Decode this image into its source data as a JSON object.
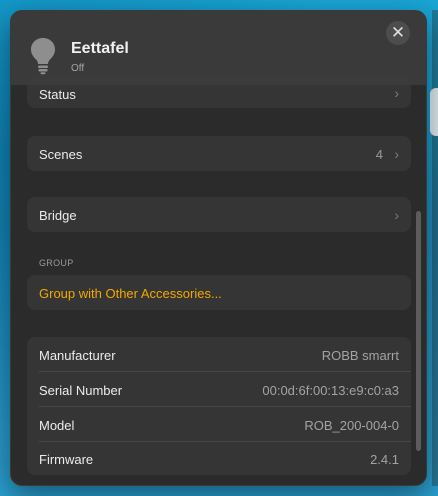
{
  "accessory": {
    "name": "Eettafel",
    "state": "Off",
    "icon": "lightbulb-icon"
  },
  "close_label": "✕",
  "rows": {
    "status": {
      "label": "Status"
    },
    "scenes": {
      "label": "Scenes",
      "count": "4"
    },
    "bridge": {
      "label": "Bridge"
    }
  },
  "group": {
    "section_label": "GROUP",
    "action_label": "Group with Other Accessories..."
  },
  "info": [
    {
      "key": "Manufacturer",
      "value": "ROBB smarrt"
    },
    {
      "key": "Serial Number",
      "value": "00:0d:6f:00:13:e9:c0:a3"
    },
    {
      "key": "Model",
      "value": "ROB_200-004-0"
    },
    {
      "key": "Firmware",
      "value": "2.4.1"
    }
  ],
  "chevron": "›",
  "colors": {
    "accent": "#f2a900",
    "panel": "#2b2b2b",
    "row": "#353535"
  }
}
